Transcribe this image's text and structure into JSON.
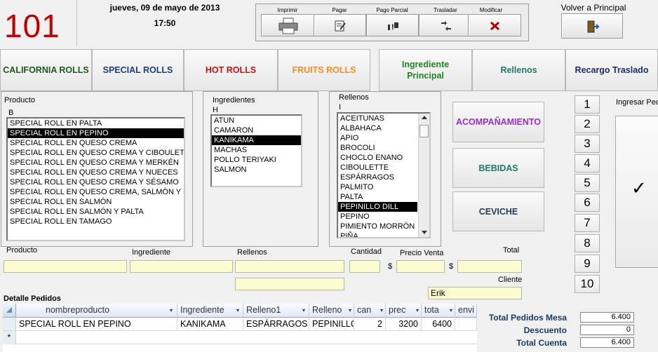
{
  "header": {
    "table_number": "101",
    "date": "jueves, 09 de mayo de 2013",
    "time": "17:50",
    "toolbar": {
      "imprimir": "Imprimir",
      "pagar": "Pagar",
      "pago_parcial": "Pago Parcial",
      "trasladar": "Trasladar",
      "modificar": "Modificar"
    },
    "volver": "Volver a Principal"
  },
  "categories": [
    {
      "label": "CALIFORNIA ROLLS",
      "color": "#1d5a1d"
    },
    {
      "label": "SPECIAL ROLLS",
      "color": "#1c3f7a"
    },
    {
      "label": "HOT ROLLS",
      "color": "#cc1111"
    },
    {
      "label": "FRUITS ROLLS",
      "color": "#ff8c1a"
    },
    {
      "label": "Ingrediente Principal",
      "color": "#1e8a1e"
    },
    {
      "label": "Rellenos",
      "color": "#1c7a6a"
    },
    {
      "label": "Recargo Traslado",
      "color": "#1c2f6a"
    }
  ],
  "producto": {
    "label": "Producto",
    "letter": "B",
    "items": [
      "SPECIAL ROLL EN PALTA",
      "SPECIAL ROLL EN PEPINO",
      "SPECIAL ROLL EN QUESO CREMA",
      "SPECIAL ROLL EN QUESO CREMA Y CIBOULETT",
      "SPECIAL ROLL EN QUESO CREMA Y MERKÉN",
      "SPECIAL ROLL EN QUESO CREMA Y NUECES",
      "SPECIAL ROLL EN QUESO CREMA Y SÉSAMO",
      "SPECIAL ROLL EN QUESO CREMA, SALMÓN Y P/",
      "SPECIAL ROLL EN SALMÓN",
      "SPECIAL ROLL EN SALMÓN Y PALTA",
      "SPECIAL ROLL EN TAMAGO"
    ],
    "selected": 1
  },
  "ingredientes": {
    "label": "Ingredientes",
    "letter": "H",
    "items": [
      "ATUN",
      "CAMARON",
      "KANIKAMA",
      "MACHAS",
      "POLLO TERIYAKI",
      "SALMON"
    ],
    "selected": 2
  },
  "rellenos": {
    "label": "Rellenos",
    "letter": "I",
    "items": [
      "ACEITUNAS",
      "ALBAHACA",
      "APIO",
      "BROCOLI",
      "CHOCLO ENANO",
      "CIBOULETTE",
      "ESPÁRRAGOS",
      "PALMITO",
      "PALTA",
      "PEPINILLO DILL",
      "PEPINO",
      "PIMIENTO MORRÓN",
      "PIÑA"
    ],
    "selected": 9
  },
  "side_buttons": {
    "acompanamiento": "ACOMPAÑAMIENTO",
    "bebidas": "BEBIDAS",
    "ceviche": "CEVICHE"
  },
  "numpad": [
    "1",
    "2",
    "3",
    "4",
    "5",
    "6",
    "7",
    "8",
    "9",
    "10"
  ],
  "ingresar": {
    "label": "Ingresar Pedido",
    "check": "✓"
  },
  "form": {
    "producto_label": "Producto",
    "ingrediente_label": "Ingrediente",
    "rellenos_label": "Rellenos",
    "cantidad_label": "Cantidad",
    "precio_label": "Precio Venta",
    "total_label": "Total",
    "currency": "$",
    "cliente_label": "Cliente",
    "cliente_value": "Erik"
  },
  "detalle": {
    "title": "Detalle Pedidos",
    "columns": [
      "nombreproducto",
      "Ingrediente",
      "Relleno1",
      "Relleno",
      "can",
      "prec",
      "tota",
      "envi"
    ],
    "rows": [
      [
        "SPECIAL ROLL EN PEPINO",
        "KANIKAMA",
        "ESPÁRRAGOS",
        "PEPINILLO",
        "2",
        "3200",
        "6400",
        ""
      ]
    ],
    "new_row_marker": "*"
  },
  "totals": {
    "total_pedidos_label": "Total Pedidos Mesa",
    "total_pedidos": "6.400",
    "descuento_label": "Descuento",
    "descuento": "0",
    "total_cuenta_label": "Total Cuenta",
    "total_cuenta": "6.400"
  }
}
